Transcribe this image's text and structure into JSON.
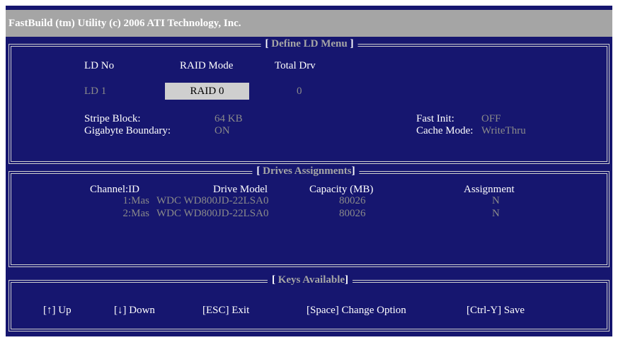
{
  "window": {
    "title": "FastBuild (tm) Utility (c) 2006 ATI Technology, Inc."
  },
  "define_menu": {
    "title": "Define LD Menu",
    "headers": {
      "ld_no": "LD No",
      "raid_mode": "RAID Mode",
      "total_drv": "Total Drv"
    },
    "ld_no": "LD  1",
    "raid_mode": "RAID 0",
    "total_drv": "0",
    "stripe_block_label": "Stripe Block:",
    "stripe_block_value": "64  KB",
    "gigabyte_boundary_label": "Gigabyte Boundary:",
    "gigabyte_boundary_value": "ON",
    "fast_init_label": "Fast Init:",
    "fast_init_value": "OFF",
    "cache_mode_label": "Cache Mode:",
    "cache_mode_value": "WriteThru"
  },
  "drives": {
    "title": "Drives Assignments",
    "headers": {
      "channel": "Channel:ID",
      "model": "Drive Model",
      "capacity": "Capacity (MB)",
      "assignment": "Assignment"
    },
    "rows": [
      {
        "channel": "1:Mas",
        "model": "WDC WD800JD-22LSA0",
        "capacity": "80026",
        "assignment": "N"
      },
      {
        "channel": "2:Mas",
        "model": "WDC WD800JD-22LSA0",
        "capacity": "80026",
        "assignment": "N"
      }
    ]
  },
  "keys": {
    "title": "Keys Available",
    "items": [
      {
        "label": "[↑] Up"
      },
      {
        "label": "[↓] Down"
      },
      {
        "label": "[ESC] Exit"
      },
      {
        "label": "[Space] Change Option"
      },
      {
        "label": "[Ctrl-Y] Save"
      }
    ]
  },
  "colors": {
    "background": "#16166f",
    "titlebar": "#a5a5a5",
    "text": "#ffffff",
    "dim_text": "#8a8a8a",
    "highlight": "#cfcfcf"
  }
}
